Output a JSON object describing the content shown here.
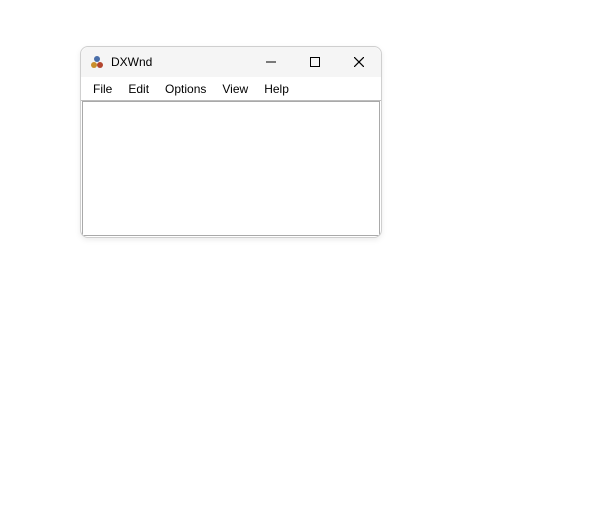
{
  "window": {
    "title": "DXWnd",
    "app_icon": "dxwnd-icon"
  },
  "menu": {
    "items": [
      "File",
      "Edit",
      "Options",
      "View",
      "Help"
    ]
  }
}
